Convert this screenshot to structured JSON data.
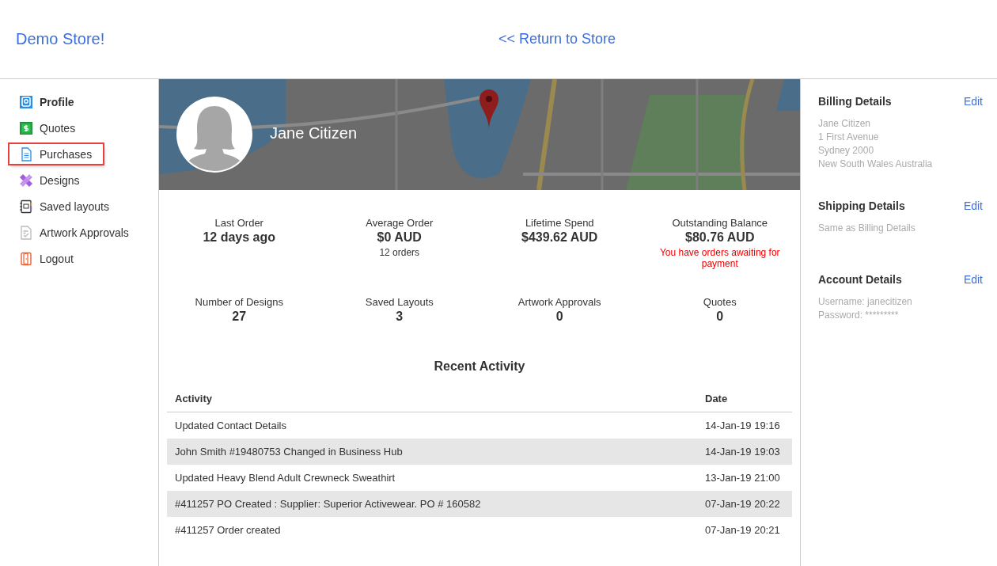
{
  "header": {
    "store_name": "Demo Store!",
    "return_link": "<< Return to Store"
  },
  "sidebar": {
    "items": [
      {
        "label": "Profile",
        "kind": "profile",
        "selected": true,
        "highlighted": false
      },
      {
        "label": "Quotes",
        "kind": "quotes",
        "selected": false,
        "highlighted": false
      },
      {
        "label": "Purchases",
        "kind": "purchases",
        "selected": false,
        "highlighted": true
      },
      {
        "label": "Designs",
        "kind": "designs",
        "selected": false,
        "highlighted": false
      },
      {
        "label": "Saved layouts",
        "kind": "layouts",
        "selected": false,
        "highlighted": false
      },
      {
        "label": "Artwork Approvals",
        "kind": "approvals",
        "selected": false,
        "highlighted": false
      },
      {
        "label": "Logout",
        "kind": "logout",
        "selected": false,
        "highlighted": false
      }
    ]
  },
  "profile": {
    "name": "Jane Citizen"
  },
  "stats": [
    {
      "label": "Last Order",
      "value": "12 days ago"
    },
    {
      "label": "Average Order",
      "value": "$0 AUD",
      "note": "12 orders"
    },
    {
      "label": "Lifetime Spend",
      "value": "$439.62 AUD"
    },
    {
      "label": "Outstanding Balance",
      "value": "$80.76 AUD",
      "warning": "You have orders awaiting for payment"
    },
    {
      "label": "Number of Designs",
      "value": "27"
    },
    {
      "label": "Saved Layouts",
      "value": "3"
    },
    {
      "label": "Artwork Approvals",
      "value": "0"
    },
    {
      "label": "Quotes",
      "value": "0"
    }
  ],
  "recent_activity": {
    "title": "Recent Activity",
    "columns": [
      "Activity",
      "Date"
    ],
    "rows": [
      [
        "Updated Contact Details",
        "14-Jan-19 19:16"
      ],
      [
        "John Smith #19480753 Changed in Business Hub",
        "14-Jan-19 19:03"
      ],
      [
        "Updated Heavy Blend Adult Crewneck Sweathirt",
        "13-Jan-19 21:00"
      ],
      [
        "#411257 PO Created : Supplier: Superior Activewear. PO # 160582",
        "07-Jan-19 20:22"
      ],
      [
        "#411257 Order created",
        "07-Jan-19 20:21"
      ]
    ]
  },
  "details": [
    {
      "title": "Billing Details",
      "action": "Edit",
      "lines": [
        "Jane Citizen",
        "1 First Avenue",
        "Sydney 2000",
        "New South Wales Australia"
      ]
    },
    {
      "title": "Shipping Details",
      "action": "Edit",
      "lines": [
        "Same as Billing Details"
      ]
    },
    {
      "title": "Account Details",
      "action": "Edit",
      "lines": [
        "Username: janecitizen",
        "Password: *********"
      ]
    }
  ]
}
